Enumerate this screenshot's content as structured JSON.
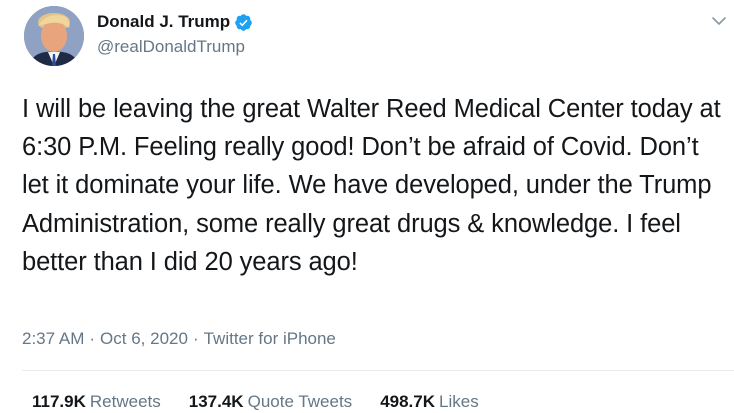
{
  "tweet": {
    "author": {
      "display_name": "Donald J. Trump",
      "handle": "@realDonaldTrump",
      "verified": true
    },
    "text": "I will be leaving the great Walter Reed Medical Center today at 6:30 P.M. Feeling really good! Don’t be afraid of Covid. Don’t let it dominate your life. We have developed, under the Trump Administration, some really great drugs & knowledge. I feel better than I did 20 years ago!",
    "time": "2:37 AM",
    "date": "Oct 6, 2020",
    "source": "Twitter for iPhone",
    "separator": "·",
    "stats": {
      "retweets_count": "117.9K",
      "retweets_label": "Retweets",
      "quote_tweets_count": "137.4K",
      "quote_tweets_label": "Quote Tweets",
      "likes_count": "498.7K",
      "likes_label": "Likes"
    }
  },
  "icons": {
    "verified": "verified-badge-icon",
    "more": "chevron-down-icon"
  },
  "colors": {
    "text_primary": "#14171a",
    "text_secondary": "#657786",
    "verified_blue": "#1da1f2",
    "divider": "#e6ecf0"
  }
}
